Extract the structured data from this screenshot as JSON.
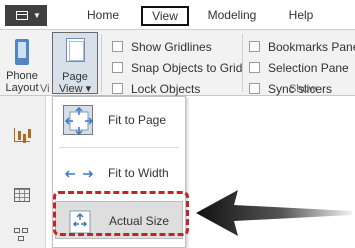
{
  "tabs": [
    {
      "label": "Home"
    },
    {
      "label": "View"
    },
    {
      "label": "Modeling"
    },
    {
      "label": "Help"
    }
  ],
  "ribbon": {
    "phone_layout": {
      "line1": "Phone",
      "line2": "Layout"
    },
    "page_view": {
      "line1": "Page",
      "line2": "View ▾"
    },
    "group_view_label": "Vi",
    "group_show_label": "Show",
    "checkboxes_col1": [
      {
        "label": "Show Gridlines",
        "checked": false
      },
      {
        "label": "Snap Objects to Grid",
        "checked": false
      },
      {
        "label": "Lock Objects",
        "checked": false
      }
    ],
    "checkboxes_col2": [
      {
        "label": "Bookmarks Pane",
        "checked": false
      },
      {
        "label": "Selection Pane",
        "checked": false
      },
      {
        "label": "Sync slicers",
        "checked": false
      }
    ]
  },
  "sidebar": {
    "items": [
      {
        "icon": "report-view-icon"
      },
      {
        "icon": "data-view-icon"
      },
      {
        "icon": "model-view-icon"
      }
    ]
  },
  "page_view_menu": {
    "items": [
      {
        "label": "Fit to Page",
        "icon": "fit-to-page-icon",
        "selected": true
      },
      {
        "label": "Fit to Width",
        "icon": "fit-to-width-icon",
        "selected": false
      },
      {
        "label": "Actual Size",
        "icon": "actual-size-icon",
        "hovered": true
      }
    ]
  },
  "colors": {
    "accent_blue": "#4e86c6",
    "highlight_red": "#c1242d",
    "file_button": "#3f3f3f"
  }
}
